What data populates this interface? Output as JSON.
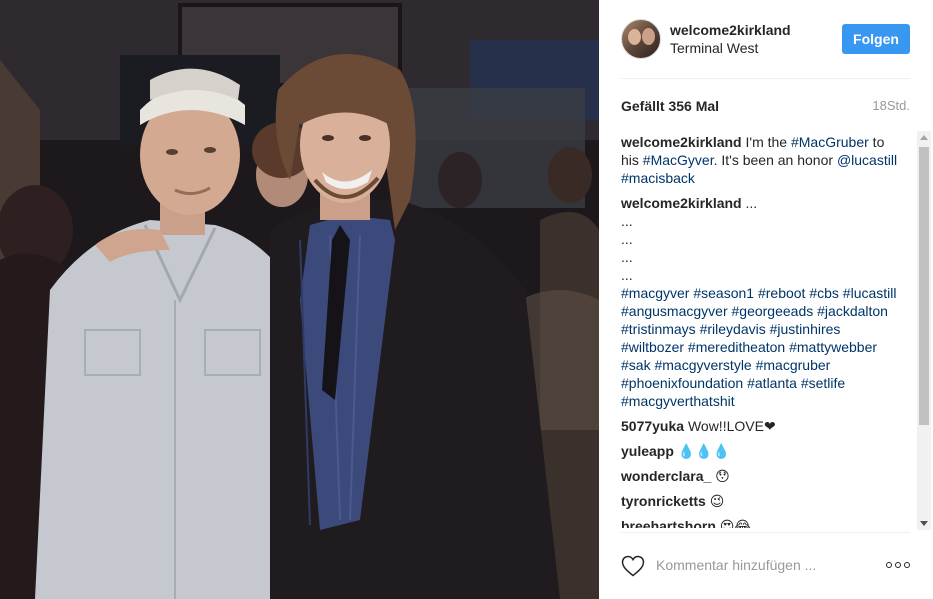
{
  "post": {
    "username": "welcome2kirkland",
    "location": "Terminal West",
    "follow_label": "Folgen",
    "likes": "Gefällt 356 Mal",
    "timestamp": "18Std."
  },
  "caption": {
    "user": "welcome2kirkland",
    "text_1": " I'm the ",
    "tag_macgruber": "#MacGruber",
    "text_2": " to his ",
    "tag_macgyver": "#MacGyver",
    "text_3": ". It's been an honor ",
    "mention": "@lucastill",
    "text_4": " ",
    "tag_macisback": "#macisback"
  },
  "hashtag_comment": {
    "user": "welcome2kirkland",
    "text": " ...",
    "dots": [
      "...",
      "...",
      "...",
      "..."
    ],
    "tags": "#macgyver #season1 #reboot #cbs #lucastill #angusmacgyver #georgeeads #jackdalton #tristinmays #rileydavis #justinhires #wiltbozer #meredi­theaton #mattywebber #sak #macgyverstyle #macgruber #phoenixfoundation #atlanta #setlife #macgyverthatshit"
  },
  "comments": [
    {
      "user": "5077yuka",
      "text": " Wow!!LOVE❤"
    },
    {
      "user": "yuleapp",
      "text": " 💧💧💧"
    },
    {
      "user": "wonderclara_",
      "text": " 😯"
    },
    {
      "user": "tyronricketts",
      "text": " 😉"
    },
    {
      "user": "breehartshorn",
      "text": " 😍😂"
    }
  ],
  "footer": {
    "comment_placeholder": "Kommentar hinzufügen ..."
  },
  "colors": {
    "follow_button": "#3897f0",
    "link": "#003569",
    "timestamp": "#999999"
  },
  "icons": [
    "heart-icon",
    "more-options-icon"
  ]
}
